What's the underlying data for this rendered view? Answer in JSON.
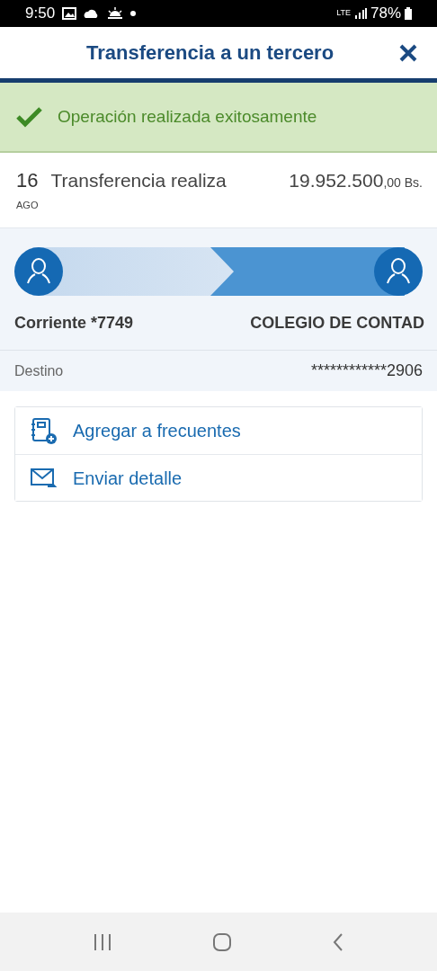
{
  "status_bar": {
    "time": "9:50",
    "network": "LTE",
    "battery": "78%"
  },
  "header": {
    "title": "Transferencia a un tercero"
  },
  "alert": {
    "kind": "success",
    "message": "Operación realizada exitosamente"
  },
  "transaction": {
    "day": "16",
    "month": "AGO",
    "description": "Transferencia realiza",
    "amount": "19.952.500",
    "amount_decimals": ",00 Bs."
  },
  "transfer": {
    "origin": "Corriente *7749",
    "destination": "COLEGIO DE CONTAD"
  },
  "details": [
    {
      "label": "Destino",
      "value": "************2906"
    }
  ],
  "actions": [
    {
      "kind": "favorite",
      "label": "Agregar a frecuentes"
    },
    {
      "kind": "send",
      "label": "Enviar detalle"
    }
  ]
}
